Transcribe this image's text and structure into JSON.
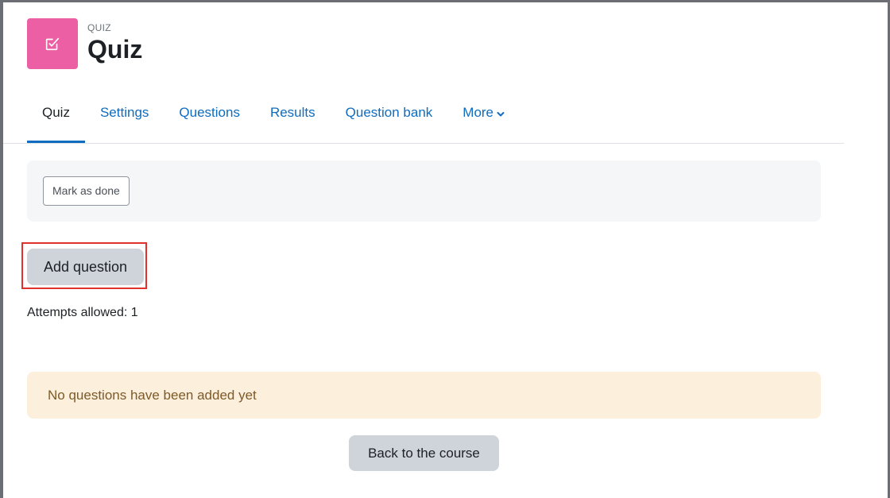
{
  "header": {
    "kicker": "QUIZ",
    "title": "Quiz",
    "icon": "checkbox-edit-icon",
    "icon_color": "#ec5fa4"
  },
  "nav": {
    "tabs": [
      {
        "label": "Quiz",
        "active": true
      },
      {
        "label": "Settings"
      },
      {
        "label": "Questions"
      },
      {
        "label": "Results"
      },
      {
        "label": "Question bank"
      },
      {
        "label": "More"
      }
    ],
    "accent_color": "#0f6cbf"
  },
  "completion": {
    "mark_done_label": "Mark as done"
  },
  "actions": {
    "add_question_label": "Add question",
    "highlight_color": "#e0312c"
  },
  "info": {
    "attempts_allowed": "Attempts allowed: 1"
  },
  "alert": {
    "message": "No questions have been added yet",
    "background_color": "#fcefdc"
  },
  "footer": {
    "back_label": "Back to the course"
  }
}
